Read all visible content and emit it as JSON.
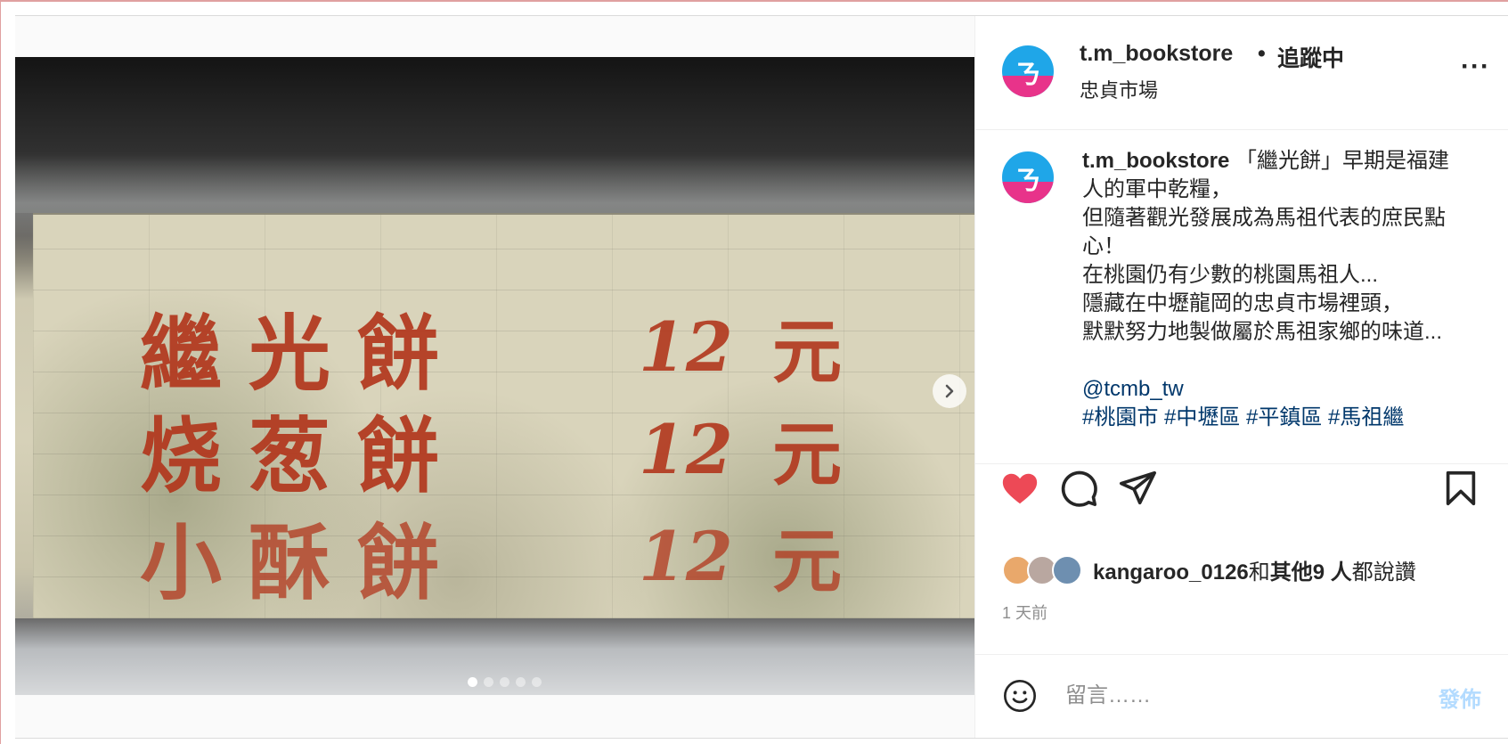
{
  "post": {
    "carousel": {
      "slide_count": 5,
      "active_slide": 1,
      "sign": {
        "rows": [
          {
            "item": "繼光餅",
            "price": "12",
            "unit": "元"
          },
          {
            "item": "烧葱餅",
            "price": "12",
            "unit": "元"
          },
          {
            "item": "小酥餅",
            "price": "12",
            "unit": "元"
          }
        ]
      }
    },
    "header": {
      "username": "t.m_bookstore",
      "separator": "•",
      "follow_state": "追蹤中",
      "location": "忠貞市場",
      "more_glyph": "···"
    },
    "caption": {
      "username": "t.m_bookstore",
      "lines": [
        "「繼光餅」早期是福建人的軍中乾糧，",
        "但隨著觀光發展成為馬祖代表的庶民點心！",
        "在桃園仍有少數的桃園馬祖人...",
        "隱藏在中壢龍岡的忠貞市場裡頭，",
        "默默努力地製做屬於馬祖家鄉的味道..."
      ],
      "mention": "@tcmb_tw",
      "hashtags": "#桃園市 #中壢區 #平鎮區 #馬祖繼"
    },
    "actions": {
      "liked": true,
      "icons": [
        "heart-icon",
        "comment-icon",
        "share-icon",
        "bookmark-icon"
      ]
    },
    "likes": {
      "first_user": "kangaroo_0126",
      "joiner": "和",
      "others": "其他9 人",
      "suffix": "都說讚"
    },
    "time_ago": "1 天前",
    "comment": {
      "placeholder": "留言……",
      "post_label": "發佈"
    }
  },
  "colors": {
    "like_red": "#ed4956",
    "text": "#262626",
    "muted": "#8e8e8e",
    "link": "#00376b",
    "post_disabled": "#b3dbff",
    "sign_ink": "#b2371d"
  }
}
